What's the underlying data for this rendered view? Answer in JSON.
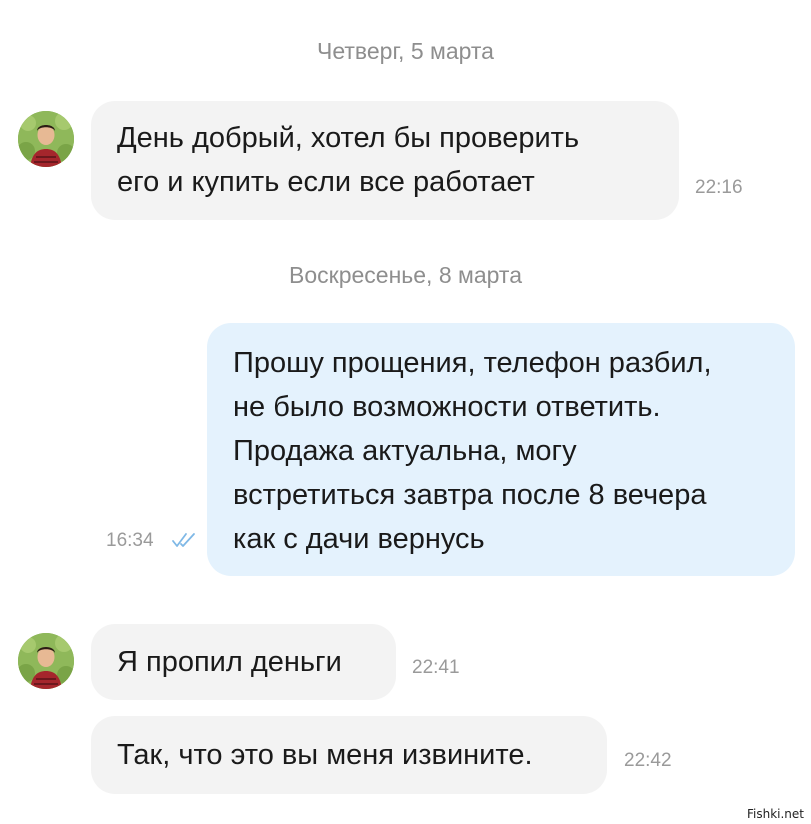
{
  "dates": [
    "Четверг, 5 марта",
    "Воскресенье, 8 марта"
  ],
  "messages": [
    {
      "text": "День добрый, хотел бы проверить\nего и купить если все работает",
      "time": "22:16"
    },
    {
      "text": "Прошу прощения, телефон разбил,\nне было возможности ответить.\nПродажа актуальна, могу\nвстретиться завтра после 8 вечера\nкак с дачи вернусь",
      "time": "16:34"
    },
    {
      "text": "Я пропил деньги",
      "time": "22:41"
    },
    {
      "text": "Так, что это вы меня извините.",
      "time": "22:42"
    }
  ],
  "watermark": "Fishki.net",
  "colors": {
    "incoming_bubble": "#f3f3f3",
    "outgoing_bubble": "#e4f2fd",
    "read_checks": "#7fb8e6"
  }
}
